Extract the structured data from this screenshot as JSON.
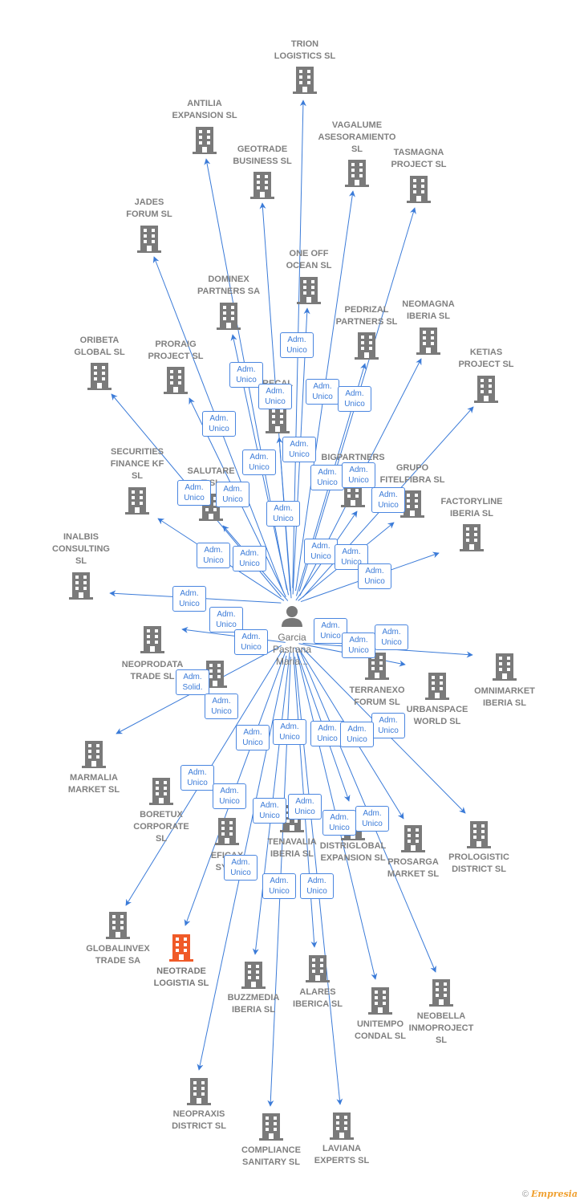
{
  "center": {
    "name_lines": [
      "Garcia",
      "Pastrana",
      "Maria..."
    ],
    "icon": "person-icon"
  },
  "colors": {
    "edge": "#3b7bd8",
    "node": "#7a7a7a",
    "highlight": "#f05a28"
  },
  "nodes": [
    {
      "lines": [
        "TRION",
        "LOGISTICS  SL"
      ]
    },
    {
      "lines": [
        "ANTILIA",
        "EXPANSION  SL"
      ]
    },
    {
      "lines": [
        "VAGALUME",
        "ASESORAMIENTO",
        "SL"
      ]
    },
    {
      "lines": [
        "GEOTRADE",
        "BUSINESS  SL"
      ]
    },
    {
      "lines": [
        "TASMAGNA",
        "PROJECT  SL"
      ]
    },
    {
      "lines": [
        "JADES",
        "FORUM  SL"
      ]
    },
    {
      "lines": [
        "ONE OFF",
        "OCEAN  SL"
      ]
    },
    {
      "lines": [
        "DOMINEX",
        "PARTNERS SA"
      ]
    },
    {
      "lines": [
        "PEDRIZAL",
        "PARTNERS  SL"
      ]
    },
    {
      "lines": [
        "NEOMAGNA",
        "IBERIA  SL"
      ]
    },
    {
      "lines": [
        "ORIBETA",
        "GLOBAL  SL"
      ]
    },
    {
      "lines": [
        "PRORAIG",
        "PROJECT  SL"
      ]
    },
    {
      "lines": [
        "KETIAS",
        "PROJECT  SL"
      ]
    },
    {
      "lines": [
        "RECAL",
        "T      SL"
      ]
    },
    {
      "lines": [
        "SECURITIES",
        "FINANCE KF",
        "SL"
      ]
    },
    {
      "lines": [
        "SALUTARE",
        "T  SL"
      ]
    },
    {
      "lines": [
        "BIGPARTNERS"
      ]
    },
    {
      "lines": [
        "GRUPO",
        "FITELFIBRA  SL"
      ]
    },
    {
      "lines": [
        "FACTORYLINE",
        "IBERIA  SL"
      ]
    },
    {
      "lines": [
        "INALBIS",
        "CONSULTING",
        "SL"
      ]
    },
    {
      "lines": [
        "NEOPRODATA",
        "TRADE  SL"
      ]
    },
    {
      "lines": [
        "TV"
      ]
    },
    {
      "lines": [
        "TERRANEXO",
        "FORUM  SL"
      ]
    },
    {
      "lines": [
        "OMNIMARKET",
        "IBERIA  SL"
      ]
    },
    {
      "lines": [
        "URBANSPACE",
        "WORLD  SL"
      ]
    },
    {
      "lines": [
        "MARMALIA",
        "MARKET  SL"
      ]
    },
    {
      "lines": [
        "BORETUX",
        "CORPORATE",
        "SL"
      ]
    },
    {
      "lines": [
        "EFICAX",
        "SYST"
      ]
    },
    {
      "lines": [
        "TENAVALIA",
        "IBERIA  SL"
      ]
    },
    {
      "lines": [
        "DISTRIGLOBAL",
        "EXPANSION  SL"
      ]
    },
    {
      "lines": [
        "PROSARGA",
        "MARKET  SL"
      ]
    },
    {
      "lines": [
        "PROLOGISTIC",
        "DISTRICT  SL"
      ]
    },
    {
      "lines": [
        "GLOBALINVEX",
        "TRADE SA"
      ]
    },
    {
      "lines": [
        "NEOTRADE",
        "LOGISTIA  SL"
      ],
      "highlight": true
    },
    {
      "lines": [
        "BUZZMEDIA",
        "IBERIA  SL"
      ]
    },
    {
      "lines": [
        "ALARES",
        "IBERICA  SL"
      ]
    },
    {
      "lines": [
        "UNITEMPO",
        "CONDAL  SL"
      ]
    },
    {
      "lines": [
        "NEOBELLA",
        "INMOPROJECT",
        "SL"
      ]
    },
    {
      "lines": [
        "NEOPRAXIS",
        "DISTRICT  SL"
      ]
    },
    {
      "lines": [
        "COMPLIANCE",
        "SANITARY  SL"
      ]
    },
    {
      "lines": [
        "LAVIANA",
        "EXPERTS  SL"
      ]
    }
  ],
  "roles": [
    "Adm. Unico",
    "Adm. Unico",
    "Adm. Unico",
    "Adm. Unico",
    "Adm. Unico",
    "Adm. Unico",
    "Adm. Unico",
    "Adm. Unico",
    "Adm. Unico",
    "Adm. Unico",
    "Adm. Unico",
    "Adm. Unico",
    "Adm. Unico",
    "Adm. Unico",
    "Adm. Unico",
    "Adm. Unico",
    "Adm. Unico",
    "Adm. Unico",
    "Adm. Unico",
    "Adm. Unico",
    "Adm. Unico",
    "Adm. Unico",
    "Adm. Unico",
    "Adm. Unico",
    "Adm. Unico",
    "Adm. Solid.",
    "Adm. Unico",
    "Adm. Unico",
    "Adm. Unico",
    "Adm. Unico",
    "Adm. Unico",
    "Adm. Unico",
    "Adm. Unico",
    "Adm. Unico",
    "Adm. Unico",
    "Adm. Unico",
    "Adm. Unico",
    "Adm. Unico",
    "Adm. Unico",
    "Adm. Unico",
    "Adm. Unico"
  ],
  "footer": {
    "copyright": "©",
    "brand": "Empresia"
  }
}
